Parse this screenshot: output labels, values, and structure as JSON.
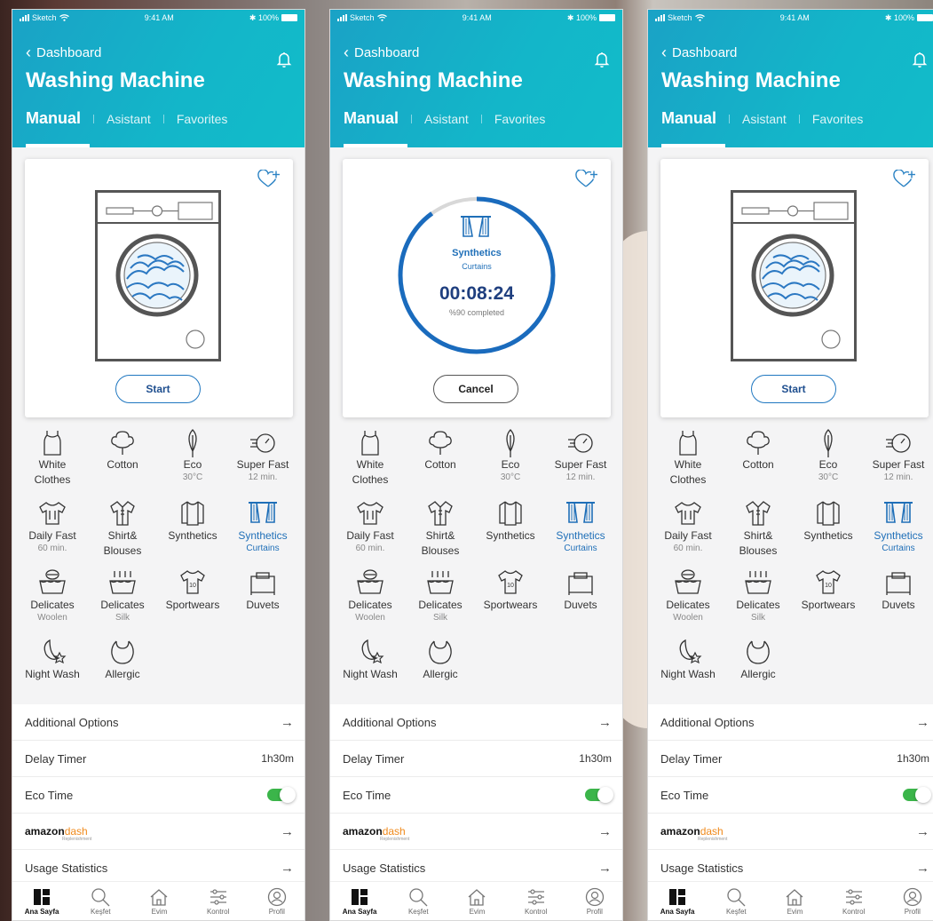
{
  "status": {
    "carrier": "Sketch",
    "time": "9:41 AM",
    "battery": "100%"
  },
  "header": {
    "back_label": "Dashboard",
    "title": "Washing Machine",
    "tabs": [
      {
        "label": "Manual",
        "active": true
      },
      {
        "label": "Asistant",
        "active": false
      },
      {
        "label": "Favorites",
        "active": false
      }
    ]
  },
  "card": {
    "start_label": "Start",
    "cancel_label": "Cancel",
    "running": {
      "program": "Synthetics",
      "sub": "Curtains",
      "time": "00:08:24",
      "completed": "%90 completed",
      "progress": 0.9
    }
  },
  "programs": [
    {
      "name": "White",
      "name2": "Clothes",
      "sub": "",
      "icon": "tank-top-icon"
    },
    {
      "name": "Cotton",
      "name2": "",
      "sub": "",
      "icon": "cotton-icon"
    },
    {
      "name": "Eco",
      "name2": "",
      "sub": "30°C",
      "icon": "leaf-icon"
    },
    {
      "name": "Super Fast",
      "name2": "",
      "sub": "12 min.",
      "icon": "speed-timer-icon"
    },
    {
      "name": "Daily Fast",
      "name2": "",
      "sub": "60 min.",
      "icon": "tshirt-icon"
    },
    {
      "name": "Shirt&",
      "name2": "Blouses",
      "sub": "",
      "icon": "shirt-icon"
    },
    {
      "name": "Synthetics",
      "name2": "",
      "sub": "",
      "icon": "jacket-icon"
    },
    {
      "name": "Synthetics",
      "name2": "",
      "sub": "Curtains",
      "icon": "curtains-icon",
      "selected": true
    },
    {
      "name": "Delicates",
      "name2": "",
      "sub": "Woolen",
      "icon": "wool-basin-icon"
    },
    {
      "name": "Delicates",
      "name2": "",
      "sub": "Silk",
      "icon": "silk-basin-icon"
    },
    {
      "name": "Sportwears",
      "name2": "",
      "sub": "",
      "icon": "jersey-icon"
    },
    {
      "name": "Duvets",
      "name2": "",
      "sub": "",
      "icon": "duvet-icon"
    },
    {
      "name": "Night Wash",
      "name2": "",
      "sub": "",
      "icon": "night-wash-icon"
    },
    {
      "name": "Allergic",
      "name2": "",
      "sub": "",
      "icon": "bib-icon"
    }
  ],
  "options": {
    "additional": "Additional Options",
    "delay_label": "Delay Timer",
    "delay_value": "1h30m",
    "eco_time": "Eco Time",
    "eco_on": true,
    "amazon_brand": "amazon",
    "amazon_dash": "dash",
    "amazon_rep": "Replenishment",
    "usage": "Usage Statistics"
  },
  "nav": [
    {
      "label": "Ana Sayfa",
      "icon": "home-grid-icon",
      "active": true
    },
    {
      "label": "Keşfet",
      "icon": "search-icon",
      "active": false
    },
    {
      "label": "Evim",
      "icon": "house-icon",
      "active": false
    },
    {
      "label": "Kontrol",
      "icon": "sliders-icon",
      "active": false
    },
    {
      "label": "Profil",
      "icon": "profile-icon",
      "active": false
    }
  ],
  "colors": {
    "header": "#13b6c9",
    "accent": "#1f6fb8",
    "toggle": "#3bb54a"
  }
}
